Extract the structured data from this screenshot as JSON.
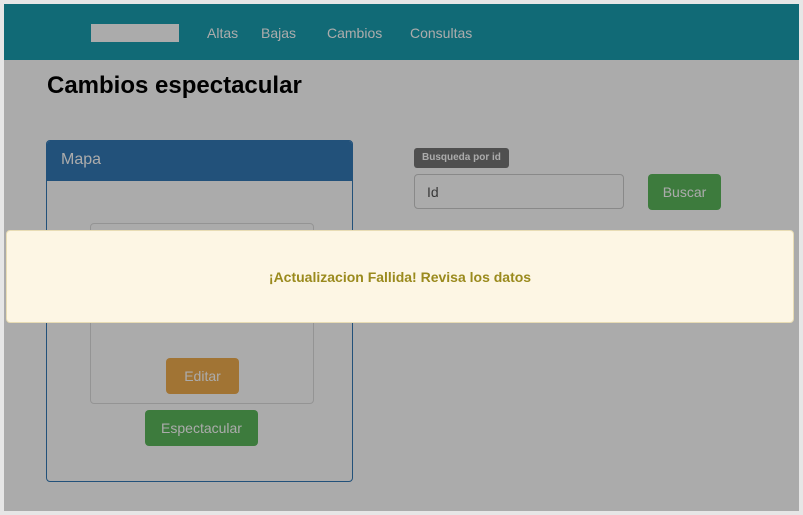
{
  "navbar": {
    "links": [
      "Altas",
      "Bajas",
      "Cambios",
      "Consultas"
    ]
  },
  "page": {
    "title": "Cambios espectacular"
  },
  "panel": {
    "heading": "Mapa",
    "edit_label": "Editar",
    "espectacular_label": "Espectacular"
  },
  "search": {
    "label": "Busqueda por id",
    "placeholder": "Id",
    "button_label": "Buscar"
  },
  "alert": {
    "message": "¡Actualizacion Fallida! Revisa los datos"
  },
  "colors": {
    "navbar": "#1a9fb0",
    "panel": "#337ab7",
    "success": "#5cb85c",
    "warning": "#f0ad4e",
    "alert_bg": "#fdf6e4",
    "alert_text": "#9a8a1d"
  }
}
